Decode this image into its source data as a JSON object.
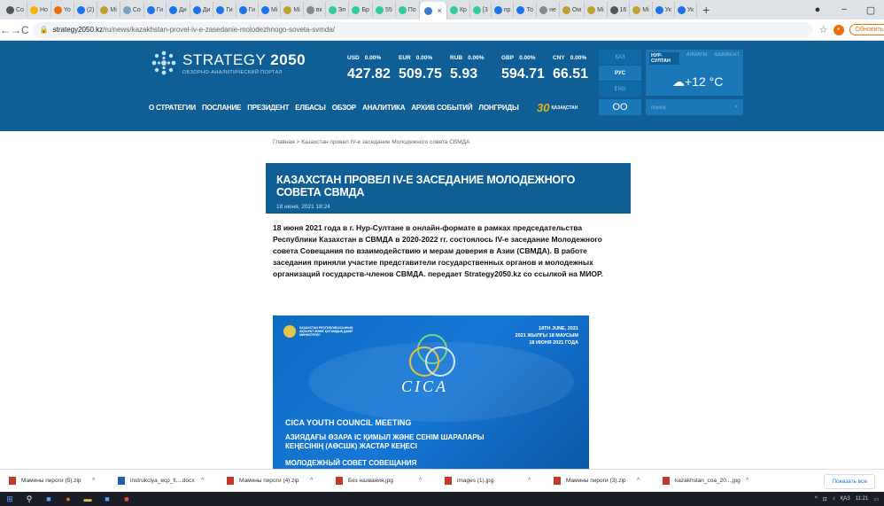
{
  "browser": {
    "tabs": [
      {
        "label": "Co",
        "color": "#555"
      },
      {
        "label": "Ho",
        "color": "#f4b400"
      },
      {
        "label": "Yo",
        "color": "#e8710a"
      },
      {
        "label": "(2)",
        "color": "#1a73e8"
      },
      {
        "label": "Mi",
        "color": "#c0a030"
      },
      {
        "label": "Co",
        "color": "#7aa0c0"
      },
      {
        "label": "Ги",
        "color": "#1a73e8"
      },
      {
        "label": "Ди",
        "color": "#1a73e8"
      },
      {
        "label": "Ди",
        "color": "#1a73e8"
      },
      {
        "label": "Ги",
        "color": "#1a73e8"
      },
      {
        "label": "Ги",
        "color": "#1a73e8"
      },
      {
        "label": "Mi",
        "color": "#1a73e8"
      },
      {
        "label": "Mi",
        "color": "#c0a030"
      },
      {
        "label": "вк",
        "color": "#888"
      },
      {
        "label": "Эл",
        "color": "#3c9"
      },
      {
        "label": "Бр",
        "color": "#3c9"
      },
      {
        "label": "55",
        "color": "#3c9"
      },
      {
        "label": "По",
        "color": "#3c9"
      }
    ],
    "active_tab": {
      "label": "×"
    },
    "tabs_after": [
      {
        "label": "Кр",
        "color": "#3c9"
      },
      {
        "label": "[3",
        "color": "#3c9"
      },
      {
        "label": "пр",
        "color": "#1a73e8"
      },
      {
        "label": "То",
        "color": "#1a73e8"
      },
      {
        "label": "не",
        "color": "#888"
      },
      {
        "label": "Ом",
        "color": "#c0a030"
      },
      {
        "label": "Mi",
        "color": "#c0a030"
      },
      {
        "label": "16",
        "color": "#555"
      },
      {
        "label": "Mi",
        "color": "#c0a030"
      },
      {
        "label": "Ук",
        "color": "#1a73e8"
      },
      {
        "label": "Ук",
        "color": "#1a73e8"
      }
    ],
    "new_tab": "+",
    "url_domain": "strategy2050.kz",
    "url_path": "/ru/news/kazakhstan-provel-iv-e-zasedanie-molodezhnogo-soveta-svmda/",
    "update_label": "Обновить",
    "win_min": "−",
    "win_max": "▢",
    "win_close": "×"
  },
  "header": {
    "logo_title": "STRATEGY",
    "logo_year": "2050",
    "logo_sub": "ОБЗОРНО-АНАЛИТИЧЕСКИЙ ПОРТАЛ",
    "rates": [
      {
        "code": "USD",
        "pct": "0.00%",
        "value": "427.82"
      },
      {
        "code": "EUR",
        "pct": "0.00%",
        "value": "509.75"
      },
      {
        "code": "RUB",
        "pct": "0.00%",
        "value": "5.93"
      },
      {
        "code": "GBP",
        "pct": "0.00%",
        "value": "594.71"
      },
      {
        "code": "CNY",
        "pct": "0.00%",
        "value": "66.51"
      }
    ],
    "langs": [
      "ҚАЗ",
      "РУС",
      "ENG"
    ],
    "lang_selected": "РУС",
    "cities": [
      "НУР-СУЛТАН",
      "АЛМАТЫ",
      "ШЫМКЕНТ"
    ],
    "temperature": "+12 °C",
    "nav": [
      "О СТРАТЕГИИ",
      "ПОСЛАНИЕ",
      "ПРЕЗИДЕНТ",
      "ЕЛБАСЫ",
      "ОБЗОР",
      "АНАЛИТИКА",
      "АРХИВ СОБЫТИЙ",
      "ЛОНГРИДЫ"
    ],
    "anniv_num": "30",
    "anniv_text": "ҚАЗАҚСТАН",
    "eyes": "OO",
    "search_placeholder": "поиск"
  },
  "article": {
    "breadcrumb_home": "Главная",
    "breadcrumb_sep": ">",
    "breadcrumb_current": "Казахстан провел IV-е заседание Молодежного совета СВМДА",
    "title": "КАЗАХСТАН ПРОВЕЛ IV-Е ЗАСЕДАНИЕ МОЛОДЕЖНОГО СОВЕТА СВМДА",
    "date": "18 июня, 2021 18:24",
    "lead": "18 июня 2021 года в г. Нур-Султане в онлайн-формате в рамках председательства Республики Казахстан в СВМДА в 2020-2022 гг. состоялось IV-е заседание Молодежного совета Совещания по взаимодействию и мерам доверия в Азии (СВМДА). В работе заседания приняли участие представители государственных органов и молодежных организаций государств-членов СВМДА. передает Strategy2050.kz со ссылкой на МИОР."
  },
  "banner": {
    "org": "КАЗАХСТАН РЕСПУБЛИКАСЫНЫҢ АҚПАРАТ ЖӘНЕ ҚОҒАМДЫҚ ДАМУ МИНИСТРЛІГІ",
    "date1": "18TH JUNE, 2021",
    "date2": "2021 ЖЫЛҒЫ 18 МАУСЫМ",
    "date3": "18 ИЮНЯ 2021 ГОДА",
    "cica": "CICA",
    "line1": "CICA YOUTH COUNCIL MEETING",
    "line2": "АЗИЯДАҒЫ ӨЗАРА ІС ҚИМЫЛ ЖӘНЕ СЕНІМ ШАРАЛАРЫ КЕҢЕСІНІҢ (АӨСШК) ЖАСТАР КЕҢЕСІ",
    "line3": "МОЛОДЕЖНЫЙ СОВЕТ СОВЕЩАНИЯ"
  },
  "downloads": {
    "items": [
      {
        "name": "Мамины пироги (5).zip",
        "color": "#c0392b"
      },
      {
        "name": "instrukciya_ecp_fi....docx",
        "color": "#1a5fb4"
      },
      {
        "name": "Мамины пироги (4).zip",
        "color": "#c0392b"
      },
      {
        "name": "Без названия.jpg",
        "color": "#c0392b"
      },
      {
        "name": "images (1).jpg",
        "color": "#c0392b"
      },
      {
        "name": "Мамины пироги (3).zip",
        "color": "#c0392b"
      },
      {
        "name": "kazakhstan_coa_20....jpg",
        "color": "#c0392b"
      }
    ],
    "chevron": "^",
    "show_all": "Показать все"
  },
  "taskbar": {
    "lang": "ҚАЗ",
    "time": "11:21"
  }
}
